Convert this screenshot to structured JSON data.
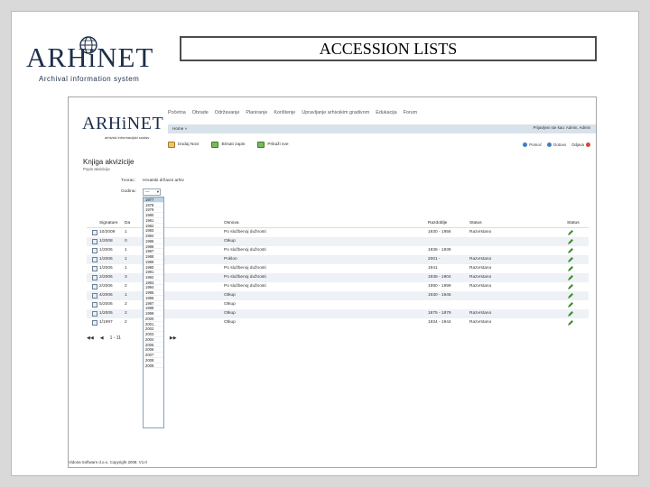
{
  "slide": {
    "logo_text": "ARHiNET",
    "logo_subtitle": "Archival information system",
    "title": "ACCESSION LISTS"
  },
  "app": {
    "logo_text": "ARHiNET",
    "logo_subtitle": "arhivski informacijski sustav",
    "nav": [
      "Početna",
      "Obrade",
      "Održavanje",
      "Planiranje",
      "Korištenje",
      "Upravljanje arhivskim gradivom",
      "Edukacija",
      "Forum"
    ],
    "breadcrumb": "Home »",
    "user_text": "Prijavljeni ste kao: Admin, Admin",
    "toolbar": [
      "Dodaj Novi",
      "Brisati zapis",
      "Prikaži sve"
    ],
    "right_actions": [
      "Pomoć",
      "Gotovo",
      "Odjava"
    ],
    "page_title": "Knjiga akvizicije",
    "page_subtitle": "Popis akvizicije",
    "filter_creator_label": "Tvorac:",
    "filter_creator_value": "Hrvatski državni arhiv",
    "filter_year_label": "Godina:",
    "filter_year_value": "---",
    "table_headers": [
      "Signature",
      "Da",
      "Osnova",
      "Razdoblje",
      "Status",
      "Status"
    ],
    "rows": [
      {
        "sig": "10/2009",
        "date": "1",
        "osnova": "Po službenoj dužnosti",
        "razdoblje": "1930 - 1956",
        "status": "Razvrstano"
      },
      {
        "sig": "1/2008",
        "date": "0",
        "osnova": "Otkup",
        "razdoblje": "",
        "status": ""
      },
      {
        "sig": "1/2006",
        "date": "1",
        "osnova": "Po službenoj dužnosti",
        "razdoblje": "1936 - 1939",
        "status": ""
      },
      {
        "sig": "1/2006",
        "date": "1",
        "osnova": "Poklon",
        "razdoblje": "2001 -",
        "status": "Razvrstano"
      },
      {
        "sig": "1/2006",
        "date": "1",
        "osnova": "Po službenoj dužnosti",
        "razdoblje": "1941",
        "status": "Razvrstano"
      },
      {
        "sig": "2/2006",
        "date": "3",
        "osnova": "Po službenoj dužnosti",
        "razdoblje": "1938 - 1904",
        "status": "Razvrstano"
      },
      {
        "sig": "2/2006",
        "date": "2",
        "osnova": "Po službenoj dužnosti",
        "razdoblje": "1990 - 1999",
        "status": "Razvrstano"
      },
      {
        "sig": "4/2006",
        "date": "1",
        "osnova": "Otkup",
        "razdoblje": "1930 - 1945",
        "status": ""
      },
      {
        "sig": "5/2006",
        "date": "2",
        "osnova": "Otkup",
        "razdoblje": "",
        "status": ""
      },
      {
        "sig": "1/2005",
        "date": "2",
        "osnova": "Otkup",
        "razdoblje": "1875 - 1879",
        "status": "Razvrstano"
      },
      {
        "sig": "1/1997",
        "date": "2",
        "osnova": "Otkup",
        "razdoblje": "1934 - 1944",
        "status": "Razvrstano"
      }
    ],
    "pager": [
      "◀◀",
      "◀",
      "1 - 11",
      "▶",
      "▶▶"
    ],
    "years": [
      "1977",
      "1978",
      "1979",
      "1980",
      "1981",
      "1982",
      "1983",
      "1984",
      "1985",
      "1986",
      "1987",
      "1988",
      "1989",
      "1990",
      "1991",
      "1992",
      "1993",
      "1994",
      "1995",
      "1996",
      "1997",
      "1998",
      "1999",
      "2000",
      "2001",
      "2002",
      "2003",
      "2004",
      "2005",
      "2006",
      "2007",
      "2008",
      "2009"
    ],
    "footer": "Vidona Software d.o.o. Copyright 2008. V1.0"
  },
  "colors": {
    "brand_navy": "#1e2f4a",
    "breadcrumb_bar": "#d8e2ea",
    "row_alt": "#eef1f5",
    "dropdown_selected": "#bcd3ea",
    "pencil_green": "#3b8d2c"
  }
}
